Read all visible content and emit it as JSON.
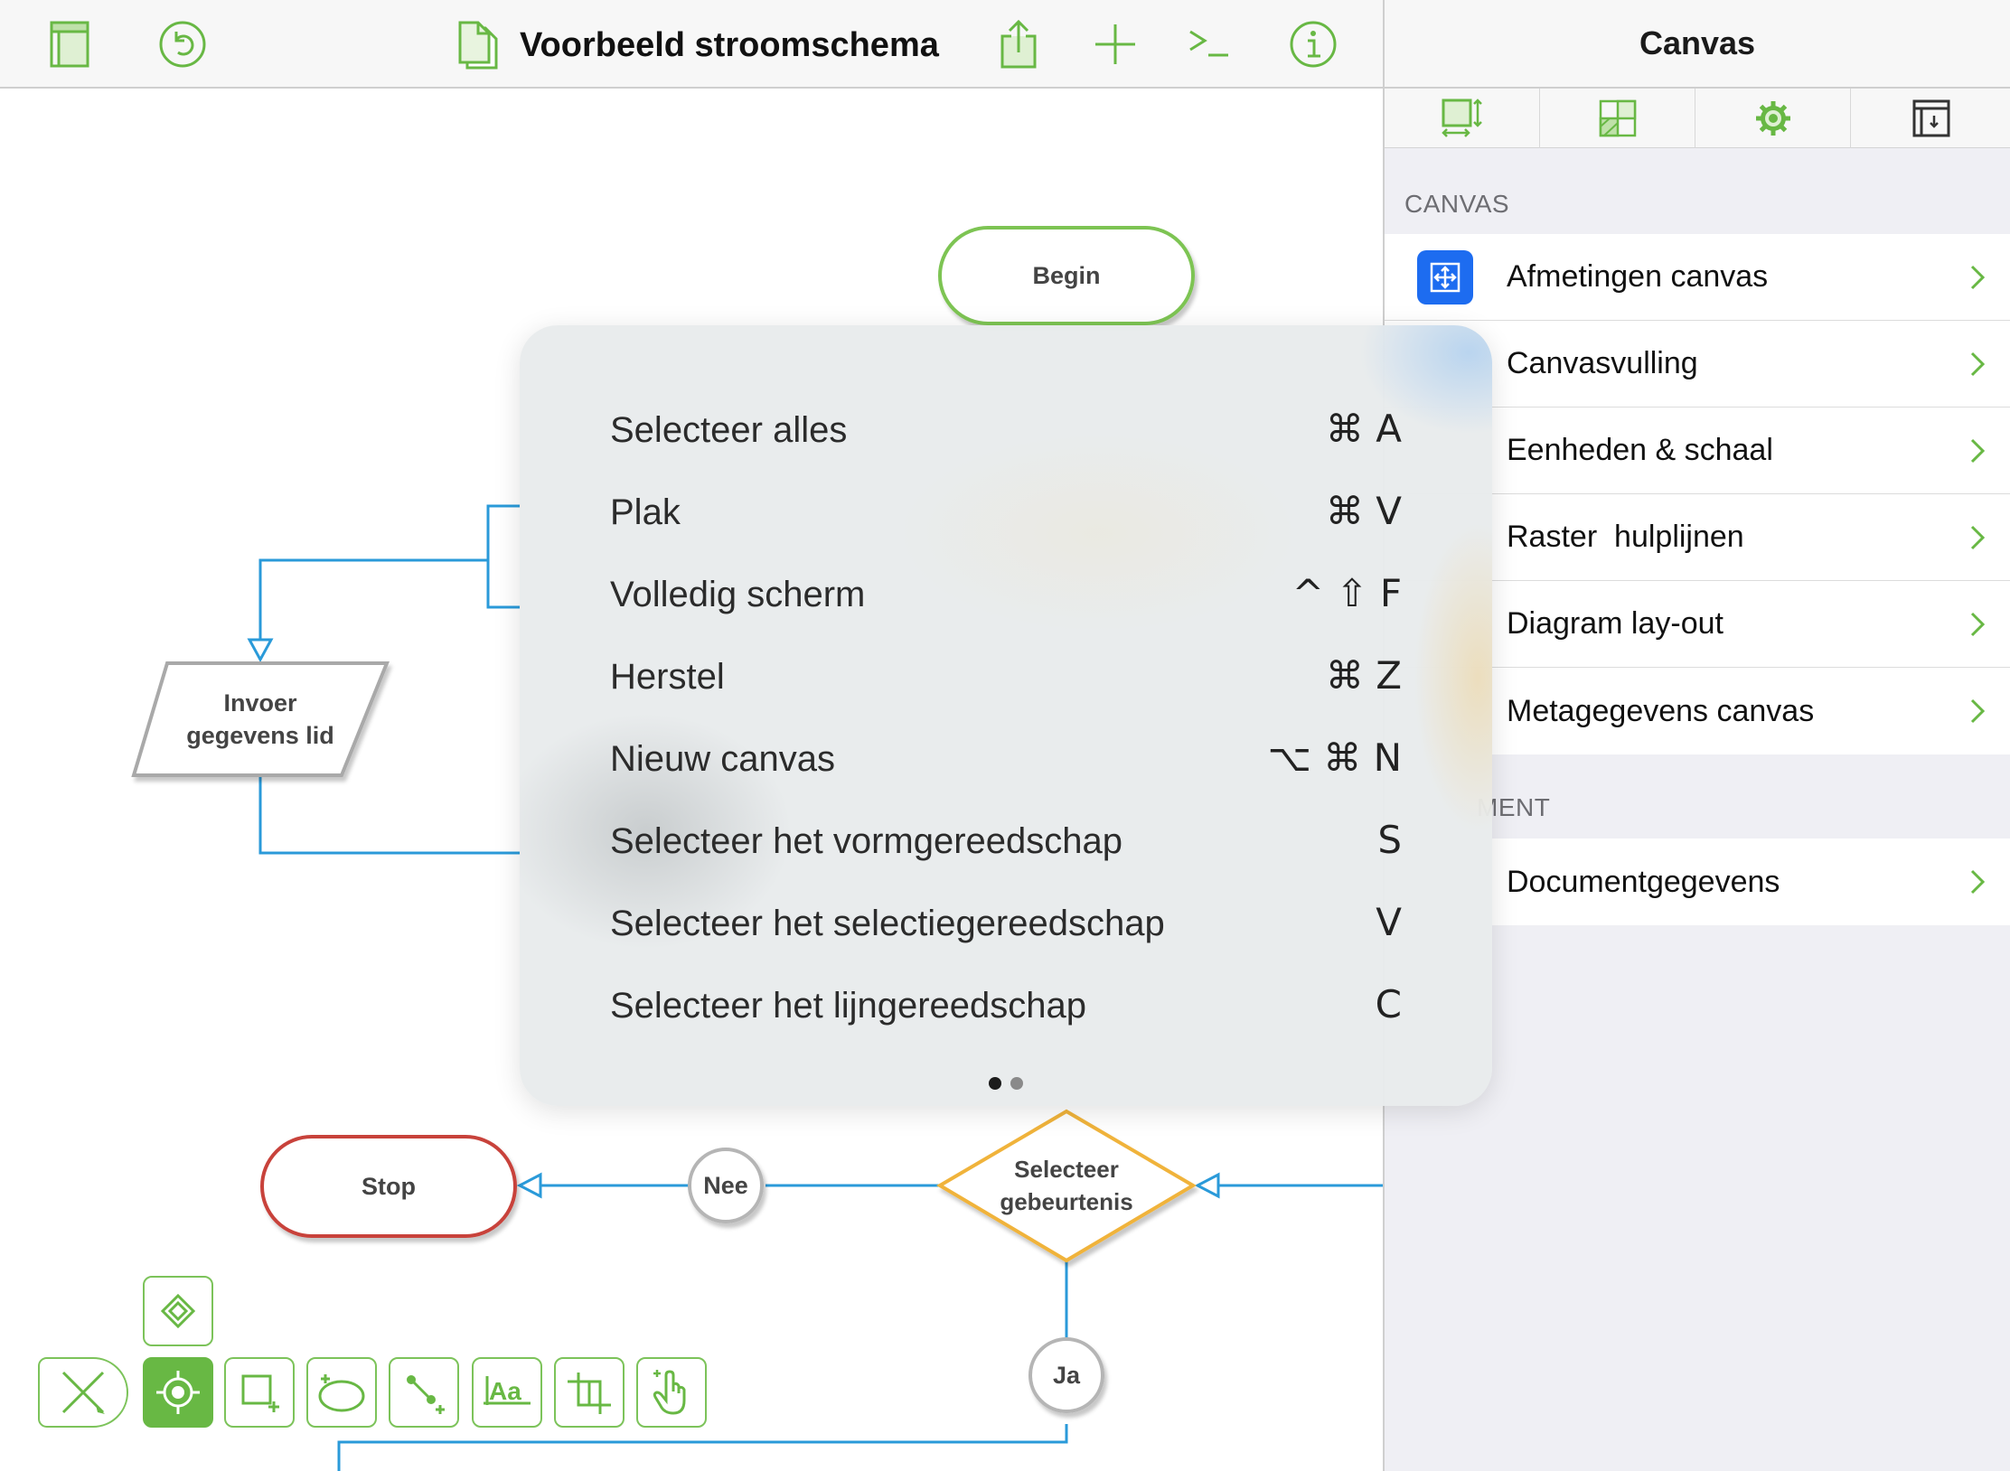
{
  "toolbar": {
    "document_title": "Voorbeeld stroomschema"
  },
  "diagram": {
    "nodes": {
      "begin": "Begin",
      "input": [
        "Invoer",
        "gegevens lid"
      ],
      "stop": "Stop",
      "decision": [
        "Selecteer",
        "gebeurtenis"
      ],
      "no": "Nee",
      "yes": "Ja"
    },
    "colors": {
      "connector": "#2a9ad9",
      "begin_stroke": "#7dc452",
      "stop_stroke": "#c8423b",
      "decision_stroke": "#f0b33b",
      "input_stroke": "#a9a9a9"
    }
  },
  "inspector": {
    "title": "Canvas",
    "tabs": [
      "canvas-size-tab-icon",
      "canvas-fill-tab-icon",
      "settings-gear-icon",
      "document-tab-icon"
    ],
    "section_canvas": "CANVAS",
    "canvas_items": [
      "Afmetingen canvas",
      "Canvasvulling",
      "Eenheden & schaal",
      "Raster  hulplijnen",
      "Diagram lay-out",
      "Metagegevens canvas"
    ],
    "section_document": "MENT",
    "document_items": [
      "Documentgegevens"
    ],
    "accent_color": "#1d6cf0"
  },
  "shortcuts": {
    "items": [
      {
        "label": "Selecteer alles",
        "keys": "⌘ A"
      },
      {
        "label": "Plak",
        "keys": "⌘ V"
      },
      {
        "label": "Volledig scherm",
        "keys": "^ ⇧ F"
      },
      {
        "label": "Herstel",
        "keys": "⌘ Z"
      },
      {
        "label": "Nieuw canvas",
        "keys": "⌥ ⌘ N"
      },
      {
        "label": "Selecteer het vormgereedschap",
        "keys": "S"
      },
      {
        "label": "Selecteer het selectiegereedschap",
        "keys": "V"
      },
      {
        "label": "Selecteer het lijngereedschap",
        "keys": "C"
      }
    ],
    "page_count": 2,
    "current_page": 1
  },
  "tools": [
    "style-pencil-icon",
    "selection-tool-icon",
    "shape-tool-icon",
    "freehand-tool-icon",
    "line-tool-icon",
    "text-tool-icon",
    "crop-tool-icon",
    "hand-tool-icon"
  ],
  "brand_color": "#68b844"
}
